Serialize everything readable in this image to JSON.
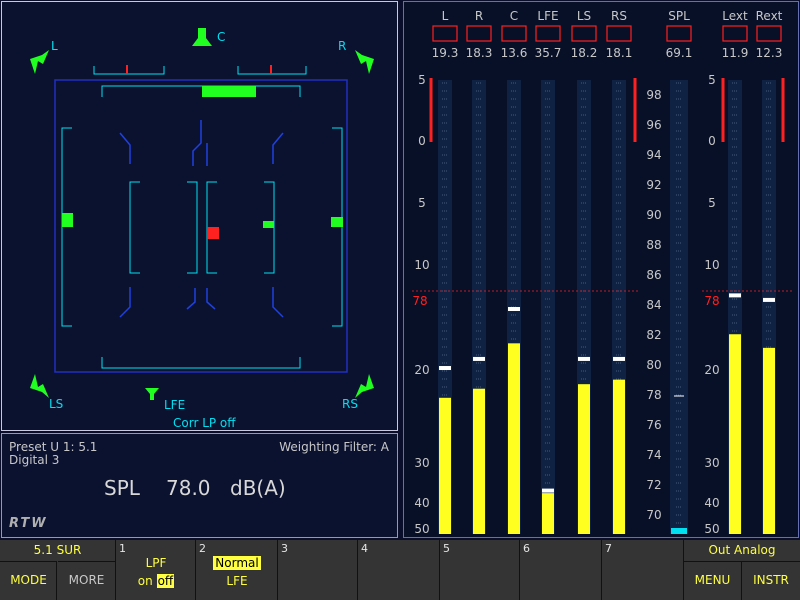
{
  "surround": {
    "labels": {
      "L": "L",
      "C": "C",
      "R": "R",
      "LS": "LS",
      "RS": "RS",
      "LFE": "LFE"
    },
    "corr_status": "Corr LP off"
  },
  "info": {
    "preset": "Preset U 1: 5.1",
    "source": "Digital 3",
    "weighting": "Weighting Filter: A",
    "spl_label": "SPL",
    "spl_value": "78.0",
    "spl_unit": "dB(A)",
    "logo": "RTW"
  },
  "meters": {
    "channels": [
      {
        "name": "L",
        "value": "19.3",
        "level": 0.3,
        "peak": 0.37
      },
      {
        "name": "R",
        "value": "18.3",
        "level": 0.32,
        "peak": 0.39
      },
      {
        "name": "C",
        "value": "13.6",
        "level": 0.42,
        "peak": 0.5
      },
      {
        "name": "LFE",
        "value": "35.7",
        "level": 0.09,
        "peak": 0.1
      },
      {
        "name": "LS",
        "value": "18.2",
        "level": 0.33,
        "peak": 0.39
      },
      {
        "name": "RS",
        "value": "18.1",
        "level": 0.34,
        "peak": 0.39
      }
    ],
    "spl": {
      "name": "SPL",
      "value": "69.1"
    },
    "ext": [
      {
        "name": "Lext",
        "value": "11.9",
        "level": 0.44,
        "peak": 0.53
      },
      {
        "name": "Rext",
        "value": "12.3",
        "level": 0.41,
        "peak": 0.52
      }
    ],
    "db_scale": [
      "5",
      "0",
      "5",
      "10",
      "20",
      "30",
      "40",
      "50"
    ],
    "ref_level": "78",
    "spl_scale": [
      "98",
      "96",
      "94",
      "92",
      "90",
      "88",
      "86",
      "84",
      "82",
      "80",
      "78",
      "76",
      "74",
      "72",
      "70"
    ]
  },
  "softkeys": {
    "mode_top": "5.1 SUR",
    "mode": "MODE",
    "more": "MORE",
    "k1_num": "1",
    "k1_label": "LPF",
    "k1_on": "on",
    "k1_off": "off",
    "k2_num": "2",
    "k2_state": "Normal",
    "k2_label": "LFE",
    "k3_num": "3",
    "k4_num": "4",
    "k5_num": "5",
    "k6_num": "6",
    "k7_num": "7",
    "out_label": "Out Analog",
    "menu": "MENU",
    "instr": "INSTR"
  },
  "colors": {
    "cyan": "#00e0f0",
    "green": "#20ff20",
    "red": "#ff2020",
    "yellow": "#ffff20",
    "frame_blue": "#2030c0"
  }
}
